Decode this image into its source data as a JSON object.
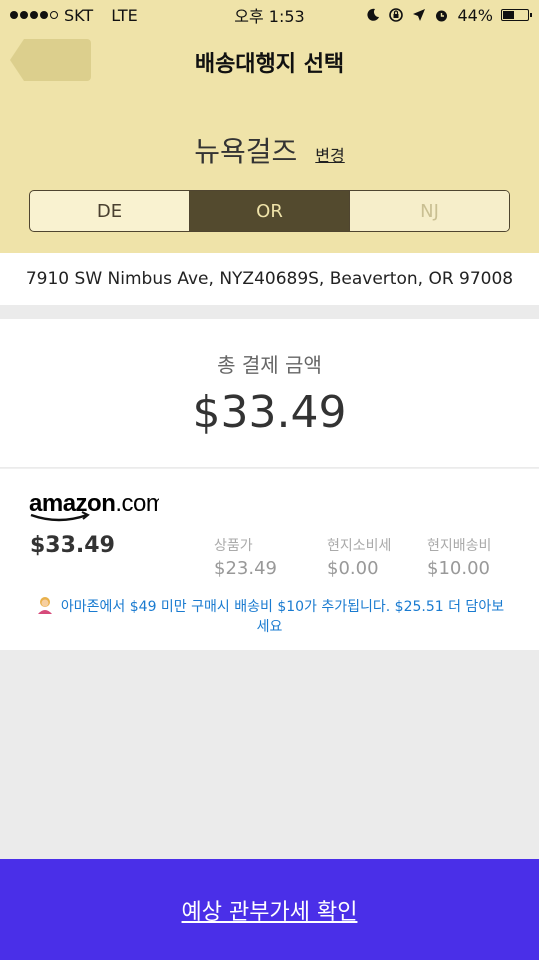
{
  "status_bar": {
    "carrier": "SKT",
    "network": "LTE",
    "time": "오후 1:53",
    "battery": "44%",
    "battery_level": 0.44
  },
  "header": {
    "title": "배송대행지 선택",
    "back_icon": "back-arrow-icon",
    "store_name": "뉴욕걸즈",
    "change_label": "변경",
    "tabs": [
      {
        "label": "DE",
        "state": "normal"
      },
      {
        "label": "OR",
        "state": "selected"
      },
      {
        "label": "NJ",
        "state": "disabled"
      }
    ]
  },
  "address": "7910 SW Nimbus Ave, NYZ40689S, Beaverton, OR 97008",
  "total": {
    "label": "총 결제 금액",
    "amount": "$33.49"
  },
  "order": {
    "merchant_logo": "amazon.com",
    "merchant_logo_bold": "amazon",
    "merchant_logo_rest": ".com",
    "subtotal": "$33.49",
    "fees": [
      {
        "label": "상품가",
        "value": "$23.49"
      },
      {
        "label": "현지소비세",
        "value": "$0.00"
      },
      {
        "label": "현지배송비",
        "value": "$10.00"
      }
    ],
    "notice_icon": "person-emoji-icon",
    "notice": "아마존에서 $49 미만 구매시 배송비 $10가 추가됩니다. $25.51 더 담아보세요"
  },
  "footer_button": "예상 관부가세 확인",
  "colors": {
    "header_bg": "#efe3a9",
    "segment_active": "#534a2e",
    "primary_button": "#4a2fe8",
    "notice_text": "#1a7bd0"
  }
}
